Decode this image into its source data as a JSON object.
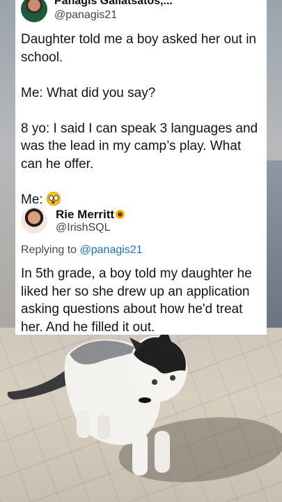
{
  "tweet1": {
    "name": "Panagis Galiatsatos,...",
    "handle": "@panagis21",
    "lines": [
      "Daughter told me a boy asked her out in school.",
      "Me: What did you say?",
      "8 yo: I said I can speak 3 languages and was the lead in my camp’s play. What can he offer.",
      "Me: "
    ],
    "emoji": "flushed-face-emoji"
  },
  "tweet2": {
    "name": "Rie Merritt",
    "name_emoji": "sunflower-emoji",
    "handle": "@IrishSQL",
    "replying_prefix": "Replying to ",
    "replying_handle": "@panagis21",
    "text": "In 5th grade, a boy told my daughter he liked her so she drew up an application asking questions about how he'd treat her. And he filled it out."
  },
  "colors": {
    "link": "#1d6fb8",
    "card_bg": "#ffffff",
    "text": "#0f1419"
  }
}
